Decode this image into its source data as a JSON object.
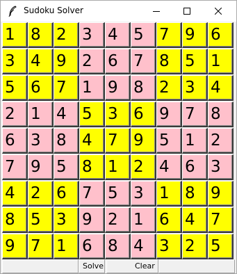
{
  "window": {
    "title": "Sudoku Solver",
    "icon": "feather-icon"
  },
  "colors": {
    "yellow": "#ffff00",
    "pink": "#ffc0cb"
  },
  "grid": [
    [
      "1",
      "8",
      "2",
      "3",
      "4",
      "5",
      "7",
      "9",
      "6"
    ],
    [
      "3",
      "4",
      "9",
      "2",
      "6",
      "7",
      "8",
      "5",
      "1"
    ],
    [
      "5",
      "6",
      "7",
      "1",
      "9",
      "8",
      "2",
      "3",
      "4"
    ],
    [
      "2",
      "1",
      "4",
      "5",
      "3",
      "6",
      "9",
      "7",
      "8"
    ],
    [
      "6",
      "3",
      "8",
      "4",
      "7",
      "9",
      "5",
      "1",
      "2"
    ],
    [
      "7",
      "9",
      "5",
      "8",
      "1",
      "2",
      "4",
      "6",
      "3"
    ],
    [
      "4",
      "2",
      "6",
      "7",
      "5",
      "3",
      "1",
      "8",
      "9"
    ],
    [
      "8",
      "5",
      "3",
      "9",
      "2",
      "1",
      "6",
      "4",
      "7"
    ],
    [
      "9",
      "7",
      "1",
      "6",
      "8",
      "4",
      "3",
      "2",
      "5"
    ]
  ],
  "buttons": {
    "solve": "Solve",
    "clear": "Clear"
  }
}
